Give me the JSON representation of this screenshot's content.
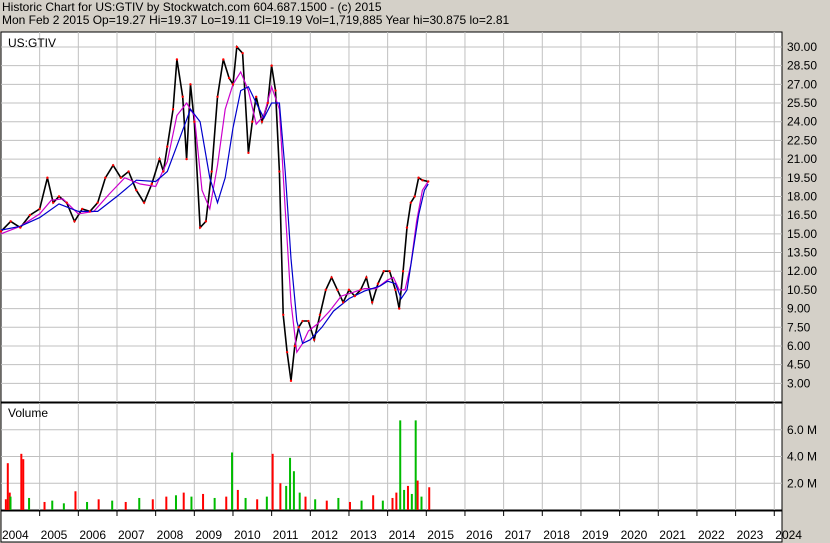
{
  "header": {
    "line1": "Historic Chart for US:GTIV by Stockwatch.com 604.687.1500 - (c) 2015",
    "line2": "Mon Feb  2 2015   Op=19.27  Hi=19.37  Lo=19.11  Cl=19.19  Vol=1,719,885  Year hi=30.875  lo=2.81"
  },
  "chart_data": [
    {
      "type": "line",
      "title": "US:GTIV",
      "ylim": [
        1.5,
        31.2
      ],
      "y_ticks": [
        "30.00",
        "28.50",
        "27.00",
        "25.50",
        "24.00",
        "22.50",
        "21.00",
        "19.50",
        "18.00",
        "16.50",
        "15.00",
        "13.50",
        "12.00",
        "10.50",
        "9.00",
        "7.50",
        "6.00",
        "4.50",
        "3.00"
      ],
      "y_tick_values": [
        30,
        28.5,
        27,
        25.5,
        24,
        22.5,
        21,
        19.5,
        18,
        16.5,
        15,
        13.5,
        12,
        10.5,
        9,
        7.5,
        6,
        4.5,
        3
      ],
      "x_ticks": [
        "2004",
        "2005",
        "2006",
        "2007",
        "2008",
        "2009",
        "2010",
        "2011",
        "2012",
        "2013",
        "2014",
        "2015",
        "2016",
        "2017",
        "2018",
        "2019",
        "2020",
        "2021",
        "2022",
        "2023",
        "2024"
      ],
      "xlim": [
        2004.0,
        2024.2
      ],
      "grid": true,
      "colors": {
        "price": "#000000",
        "ma_short": "#cc00cc",
        "ma_long": "#0000cc",
        "red": "#ff0000"
      },
      "series": [
        {
          "x": [
            2004.0,
            2004.25,
            2004.5,
            2004.75,
            2005.0,
            2005.2,
            2005.35,
            2005.5,
            2005.7,
            2005.9,
            2006.1,
            2006.3,
            2006.5,
            2006.7,
            2006.9,
            2007.1,
            2007.3,
            2007.5,
            2007.7,
            2007.9,
            2008.1,
            2008.2,
            2008.3,
            2008.45,
            2008.55,
            2008.7,
            2008.8,
            2008.9,
            2009.0,
            2009.15,
            2009.3,
            2009.45,
            2009.6,
            2009.75,
            2009.9,
            2010.0,
            2010.1,
            2010.25,
            2010.4,
            2010.5,
            2010.6,
            2010.75,
            2010.9,
            2011.0,
            2011.1,
            2011.2,
            2011.3,
            2011.4,
            2011.5,
            2011.6,
            2011.7,
            2011.8,
            2011.95,
            2012.1,
            2012.25,
            2012.4,
            2012.55,
            2012.7,
            2012.85,
            2013.0,
            2013.15,
            2013.3,
            2013.45,
            2013.6,
            2013.75,
            2013.9,
            2014.05,
            2014.2,
            2014.3,
            2014.4,
            2014.5,
            2014.6,
            2014.7,
            2014.8,
            2014.9,
            2015.05
          ],
          "values": [
            15.2,
            16.0,
            15.5,
            16.5,
            17.0,
            19.5,
            17.5,
            18.0,
            17.5,
            16.0,
            17.0,
            16.8,
            17.5,
            19.5,
            20.5,
            19.5,
            20.0,
            18.5,
            17.5,
            19.0,
            21.0,
            20.0,
            22.0,
            25.0,
            29.0,
            26.0,
            21.0,
            27.0,
            24.0,
            15.5,
            16.0,
            20.0,
            26.0,
            29.0,
            27.5,
            27.0,
            30.0,
            29.5,
            21.5,
            24.0,
            26.0,
            24.0,
            25.5,
            28.5,
            26.5,
            20.0,
            8.5,
            5.5,
            3.2,
            6.0,
            7.5,
            8.0,
            8.0,
            6.5,
            8.5,
            10.5,
            11.5,
            10.5,
            9.5,
            10.5,
            10.0,
            10.5,
            11.5,
            9.5,
            11.0,
            12.0,
            12.0,
            10.5,
            9.0,
            12.0,
            15.5,
            17.5,
            18.0,
            19.5,
            19.3,
            19.2
          ]
        },
        {
          "x": [
            2004.0,
            2004.5,
            2005.0,
            2005.3,
            2005.6,
            2006.0,
            2006.4,
            2006.8,
            2007.2,
            2007.6,
            2008.0,
            2008.3,
            2008.55,
            2008.8,
            2009.0,
            2009.2,
            2009.4,
            2009.6,
            2009.8,
            2010.0,
            2010.2,
            2010.4,
            2010.6,
            2010.8,
            2011.0,
            2011.2,
            2011.35,
            2011.5,
            2011.65,
            2011.8,
            2011.95,
            2012.2,
            2012.5,
            2012.8,
            2013.1,
            2013.4,
            2013.7,
            2014.0,
            2014.15,
            2014.3,
            2014.45,
            2014.6,
            2014.75,
            2014.9,
            2015.05
          ],
          "values": [
            15.0,
            15.6,
            16.6,
            17.7,
            17.8,
            16.6,
            16.8,
            18.2,
            19.5,
            19.0,
            18.8,
            20.8,
            24.5,
            25.5,
            24.5,
            18.5,
            17.0,
            20.5,
            25.0,
            27.0,
            28.0,
            26.5,
            23.8,
            24.5,
            26.8,
            25.0,
            17.0,
            9.5,
            5.5,
            6.2,
            7.2,
            7.8,
            8.8,
            10.0,
            10.3,
            10.6,
            10.6,
            11.3,
            11.5,
            10.5,
            10.5,
            12.5,
            16.0,
            18.5,
            19.2
          ]
        },
        {
          "x": [
            2004.0,
            2004.5,
            2005.0,
            2005.5,
            2006.0,
            2006.5,
            2007.0,
            2007.5,
            2008.0,
            2008.3,
            2008.6,
            2008.9,
            2009.15,
            2009.4,
            2009.6,
            2009.8,
            2010.0,
            2010.2,
            2010.4,
            2010.6,
            2010.8,
            2011.0,
            2011.2,
            2011.35,
            2011.5,
            2011.65,
            2011.8,
            2012.0,
            2012.3,
            2012.6,
            2013.0,
            2013.4,
            2013.8,
            2014.0,
            2014.2,
            2014.35,
            2014.5,
            2014.65,
            2014.8,
            2014.95,
            2015.05
          ],
          "values": [
            15.3,
            15.6,
            16.3,
            17.4,
            16.8,
            16.8,
            18.0,
            19.3,
            19.2,
            20.0,
            22.5,
            25.0,
            24.0,
            19.5,
            17.5,
            19.5,
            23.5,
            26.5,
            26.8,
            25.5,
            24.3,
            25.5,
            25.5,
            20.0,
            13.0,
            8.0,
            6.2,
            6.5,
            7.5,
            8.8,
            9.8,
            10.4,
            10.8,
            11.2,
            11.0,
            9.8,
            10.5,
            13.5,
            16.5,
            18.5,
            19.0
          ]
        }
      ]
    },
    {
      "type": "bar",
      "title": "Volume",
      "ylim": [
        0,
        8000000
      ],
      "y_ticks": [
        "6.0 M",
        "4.0 M",
        "2.0 M"
      ],
      "y_tick_values": [
        6000000,
        4000000,
        2000000
      ],
      "colors": {
        "up": "#00bb00",
        "down": "#ff0000"
      },
      "bars": [
        {
          "x": 2004.1,
          "v": 800000,
          "c": "red"
        },
        {
          "x": 2004.15,
          "v": 3500000,
          "c": "red"
        },
        {
          "x": 2004.2,
          "v": 1300000,
          "c": "red"
        },
        {
          "x": 2004.22,
          "v": 1000000,
          "c": "green"
        },
        {
          "x": 2004.5,
          "v": 4200000,
          "c": "red"
        },
        {
          "x": 2004.55,
          "v": 3800000,
          "c": "red"
        },
        {
          "x": 2004.7,
          "v": 900000,
          "c": "green"
        },
        {
          "x": 2005.1,
          "v": 600000,
          "c": "red"
        },
        {
          "x": 2005.3,
          "v": 700000,
          "c": "green"
        },
        {
          "x": 2005.6,
          "v": 500000,
          "c": "green"
        },
        {
          "x": 2005.9,
          "v": 1400000,
          "c": "red"
        },
        {
          "x": 2006.2,
          "v": 600000,
          "c": "green"
        },
        {
          "x": 2006.5,
          "v": 800000,
          "c": "red"
        },
        {
          "x": 2006.85,
          "v": 700000,
          "c": "green"
        },
        {
          "x": 2007.2,
          "v": 600000,
          "c": "red"
        },
        {
          "x": 2007.55,
          "v": 900000,
          "c": "green"
        },
        {
          "x": 2007.9,
          "v": 800000,
          "c": "red"
        },
        {
          "x": 2008.25,
          "v": 1000000,
          "c": "red"
        },
        {
          "x": 2008.5,
          "v": 1100000,
          "c": "green"
        },
        {
          "x": 2008.7,
          "v": 1300000,
          "c": "red"
        },
        {
          "x": 2008.9,
          "v": 1000000,
          "c": "green"
        },
        {
          "x": 2009.2,
          "v": 1200000,
          "c": "red"
        },
        {
          "x": 2009.5,
          "v": 900000,
          "c": "green"
        },
        {
          "x": 2009.8,
          "v": 1000000,
          "c": "red"
        },
        {
          "x": 2009.95,
          "v": 4300000,
          "c": "green"
        },
        {
          "x": 2010.1,
          "v": 1500000,
          "c": "red"
        },
        {
          "x": 2010.3,
          "v": 900000,
          "c": "green"
        },
        {
          "x": 2010.6,
          "v": 800000,
          "c": "red"
        },
        {
          "x": 2010.85,
          "v": 1000000,
          "c": "green"
        },
        {
          "x": 2011.0,
          "v": 4200000,
          "c": "red"
        },
        {
          "x": 2011.2,
          "v": 2000000,
          "c": "red"
        },
        {
          "x": 2011.35,
          "v": 1800000,
          "c": "green"
        },
        {
          "x": 2011.45,
          "v": 3900000,
          "c": "green"
        },
        {
          "x": 2011.55,
          "v": 2900000,
          "c": "green"
        },
        {
          "x": 2011.7,
          "v": 1300000,
          "c": "green"
        },
        {
          "x": 2011.85,
          "v": 1000000,
          "c": "red"
        },
        {
          "x": 2012.1,
          "v": 800000,
          "c": "green"
        },
        {
          "x": 2012.4,
          "v": 700000,
          "c": "red"
        },
        {
          "x": 2012.7,
          "v": 900000,
          "c": "green"
        },
        {
          "x": 2013.0,
          "v": 600000,
          "c": "red"
        },
        {
          "x": 2013.3,
          "v": 700000,
          "c": "green"
        },
        {
          "x": 2013.6,
          "v": 1100000,
          "c": "red"
        },
        {
          "x": 2013.85,
          "v": 700000,
          "c": "green"
        },
        {
          "x": 2014.1,
          "v": 900000,
          "c": "red"
        },
        {
          "x": 2014.2,
          "v": 1300000,
          "c": "red"
        },
        {
          "x": 2014.3,
          "v": 6700000,
          "c": "green"
        },
        {
          "x": 2014.4,
          "v": 1500000,
          "c": "green"
        },
        {
          "x": 2014.5,
          "v": 1800000,
          "c": "red"
        },
        {
          "x": 2014.6,
          "v": 1200000,
          "c": "green"
        },
        {
          "x": 2014.7,
          "v": 6700000,
          "c": "green"
        },
        {
          "x": 2014.75,
          "v": 2200000,
          "c": "red"
        },
        {
          "x": 2014.85,
          "v": 1000000,
          "c": "green"
        },
        {
          "x": 2015.05,
          "v": 1700000,
          "c": "red"
        }
      ]
    }
  ]
}
